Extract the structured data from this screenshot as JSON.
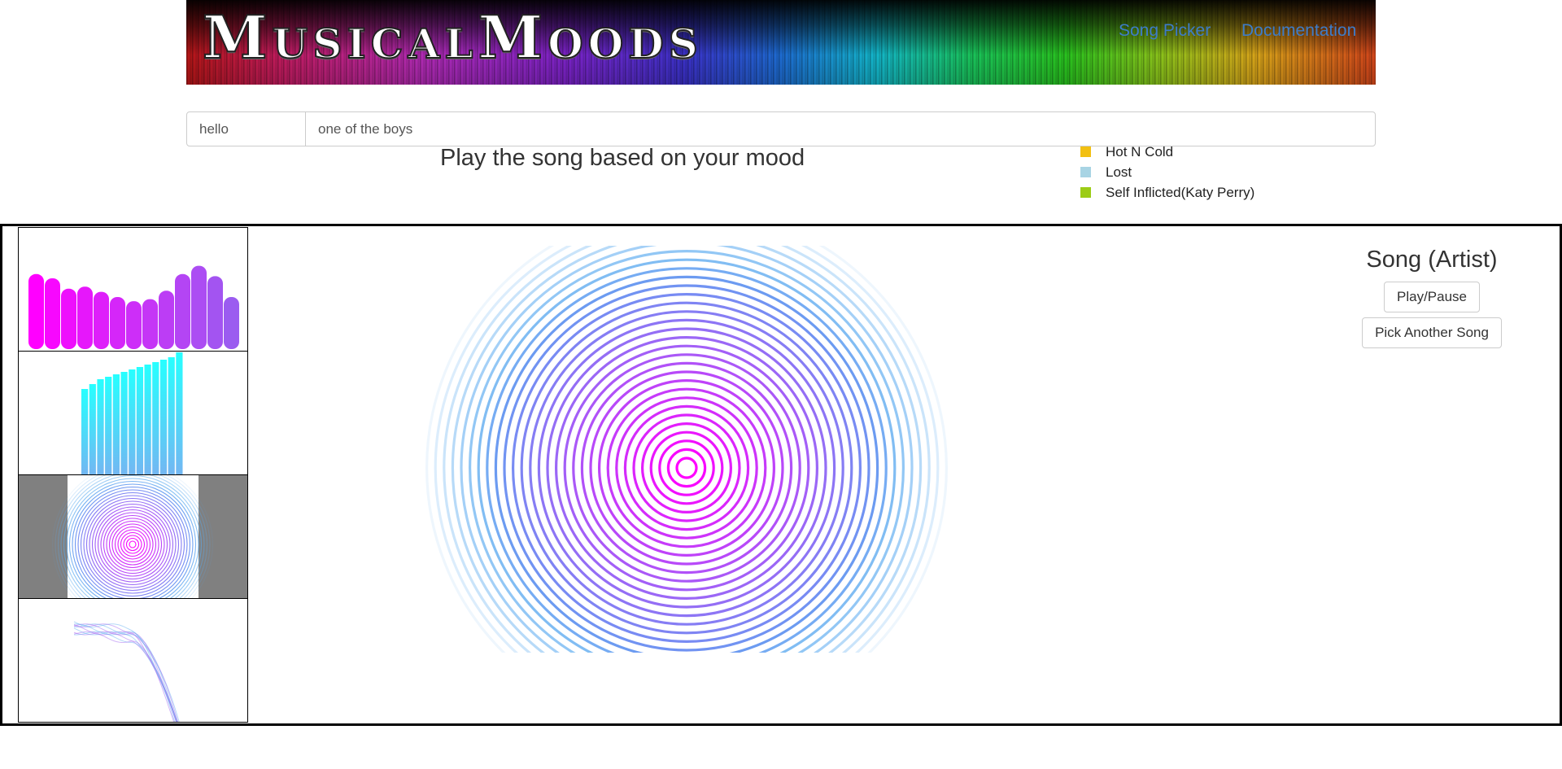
{
  "header": {
    "logo_text": "MusicalMoods",
    "nav": [
      {
        "label": "Song Picker"
      },
      {
        "label": "Documentation"
      }
    ]
  },
  "form": {
    "name_value": "hello",
    "song_value": "one of the boys"
  },
  "tagline": "Play the song based on your mood",
  "legend": [
    {
      "label": "Hot N Cold",
      "color": "#f2c012"
    },
    {
      "label": "Lost",
      "color": "#a8d4e4"
    },
    {
      "label": "Self Inflicted(Katy Perry)",
      "color": "#9ccc16"
    }
  ],
  "player": {
    "title": "Song (Artist)",
    "play_pause_label": "Play/Pause",
    "pick_another_label": "Pick Another Song"
  },
  "visualizations": {
    "bar_levels": [
      0.72,
      0.68,
      0.58,
      0.6,
      0.55,
      0.5,
      0.46,
      0.48,
      0.56,
      0.72,
      0.8,
      0.7,
      0.5
    ],
    "tower_levels": [
      0.7,
      0.74,
      0.78,
      0.8,
      0.82,
      0.84,
      0.86,
      0.88,
      0.9,
      0.92,
      0.94,
      0.96,
      1.0
    ],
    "colors": {
      "magenta": "#ff00ff",
      "violet": "#9b5cf0",
      "cyan": "#00ffff",
      "blue": "#5aaaf0"
    }
  }
}
